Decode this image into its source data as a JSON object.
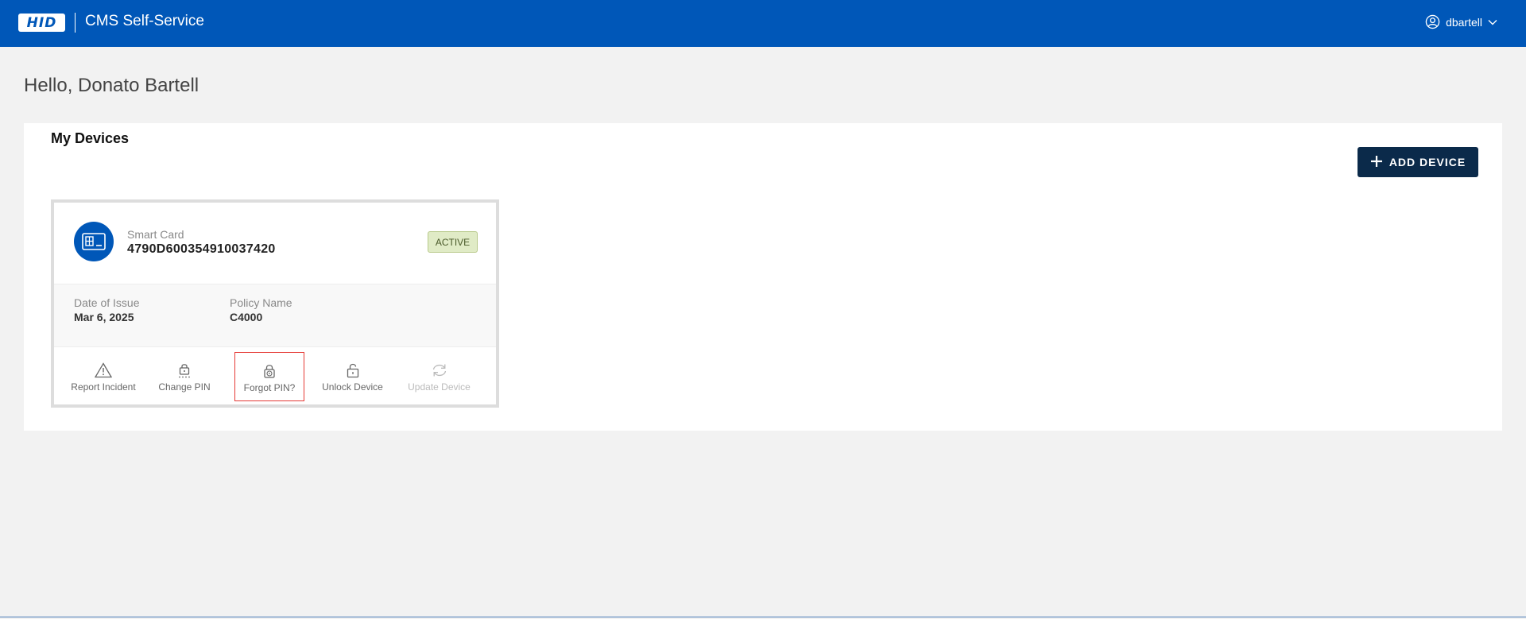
{
  "header": {
    "logo_text": "HID",
    "app_title": "CMS Self-Service",
    "username": "dbartell"
  },
  "greeting": "Hello, Donato Bartell",
  "devices_panel": {
    "title": "My Devices",
    "add_button_label": "ADD DEVICE",
    "device": {
      "type": "Smart Card",
      "id": "4790D600354910037420",
      "status": "ACTIVE",
      "date_of_issue_label": "Date of Issue",
      "date_of_issue": "Mar 6, 2025",
      "policy_name_label": "Policy Name",
      "policy_name": "C4000",
      "actions": {
        "report_incident": "Report Incident",
        "change_pin": "Change PIN",
        "forgot_pin": "Forgot PIN?",
        "unlock_device": "Unlock Device",
        "update_device": "Update Device"
      }
    }
  },
  "colors": {
    "header_bg": "#0057b8",
    "add_button_bg": "#0b2a4a",
    "active_badge_bg": "#e0ebc6",
    "highlight_border": "#e53935"
  }
}
